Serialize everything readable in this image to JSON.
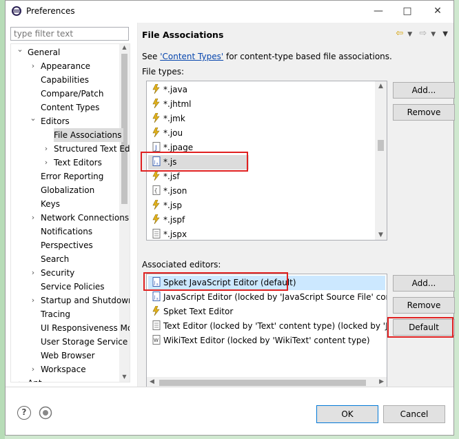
{
  "window": {
    "title": "Preferences",
    "minimize": "—",
    "maximize": "□",
    "close": "✕"
  },
  "filter": {
    "placeholder": "type filter text"
  },
  "tree": {
    "items": [
      {
        "label": "General",
        "level": 0,
        "expander": "open"
      },
      {
        "label": "Appearance",
        "level": 1,
        "expander": "closed"
      },
      {
        "label": "Capabilities",
        "level": 1,
        "expander": "none"
      },
      {
        "label": "Compare/Patch",
        "level": 1,
        "expander": "none"
      },
      {
        "label": "Content Types",
        "level": 1,
        "expander": "none"
      },
      {
        "label": "Editors",
        "level": 1,
        "expander": "open"
      },
      {
        "label": "File Associations",
        "level": 2,
        "expander": "none",
        "selected": true
      },
      {
        "label": "Structured Text Editors",
        "level": 2,
        "expander": "closed"
      },
      {
        "label": "Text Editors",
        "level": 2,
        "expander": "closed"
      },
      {
        "label": "Error Reporting",
        "level": 1,
        "expander": "none"
      },
      {
        "label": "Globalization",
        "level": 1,
        "expander": "none"
      },
      {
        "label": "Keys",
        "level": 1,
        "expander": "none"
      },
      {
        "label": "Network Connections",
        "level": 1,
        "expander": "closed"
      },
      {
        "label": "Notifications",
        "level": 1,
        "expander": "none"
      },
      {
        "label": "Perspectives",
        "level": 1,
        "expander": "none"
      },
      {
        "label": "Search",
        "level": 1,
        "expander": "none"
      },
      {
        "label": "Security",
        "level": 1,
        "expander": "closed"
      },
      {
        "label": "Service Policies",
        "level": 1,
        "expander": "none"
      },
      {
        "label": "Startup and Shutdown",
        "level": 1,
        "expander": "closed"
      },
      {
        "label": "Tracing",
        "level": 1,
        "expander": "none"
      },
      {
        "label": "UI Responsiveness Monitoring",
        "level": 1,
        "expander": "none"
      },
      {
        "label": "User Storage Service",
        "level": 1,
        "expander": "none"
      },
      {
        "label": "Web Browser",
        "level": 1,
        "expander": "none"
      },
      {
        "label": "Workspace",
        "level": 1,
        "expander": "closed"
      },
      {
        "label": "Ant",
        "level": 0,
        "expander": "closed"
      }
    ]
  },
  "page": {
    "title": "File Associations",
    "see_prefix": "See ",
    "see_link": "'Content Types'",
    "see_suffix": " for content-type based file associations.",
    "file_types_label": "File types:",
    "associated_label": "Associated editors:"
  },
  "file_types": [
    {
      "name": "*.java",
      "icon": "lightning-icon"
    },
    {
      "name": "*.jhtml",
      "icon": "lightning-icon"
    },
    {
      "name": "*.jmk",
      "icon": "lightning-icon"
    },
    {
      "name": "*.jou",
      "icon": "lightning-icon"
    },
    {
      "name": "*.jpage",
      "icon": "j-file-icon"
    },
    {
      "name": "*.js",
      "icon": "js-file-icon",
      "selected": true
    },
    {
      "name": "*.jsf",
      "icon": "lightning-icon"
    },
    {
      "name": "*.json",
      "icon": "json-file-icon"
    },
    {
      "name": "*.jsp",
      "icon": "lightning-icon"
    },
    {
      "name": "*.jspf",
      "icon": "lightning-icon"
    },
    {
      "name": "*.jspx",
      "icon": "text-file-icon"
    }
  ],
  "editors": [
    {
      "name": "Spket JavaScript Editor (default)",
      "icon": "js-file-icon",
      "selected": true
    },
    {
      "name": "JavaScript Editor (locked by 'JavaScript Source File' content type)",
      "icon": "js-file-icon"
    },
    {
      "name": "Spket Text Editor",
      "icon": "lightning-icon"
    },
    {
      "name": "Text Editor (locked by 'Text' content type) (locked by 'Java",
      "icon": "text-file-icon"
    },
    {
      "name": "WikiText Editor (locked by 'WikiText' content type)",
      "icon": "wiki-icon"
    }
  ],
  "buttons": {
    "add_types": "Add...",
    "remove_types": "Remove",
    "add_editors": "Add...",
    "remove_editors": "Remove",
    "default": "Default",
    "ok": "OK",
    "cancel": "Cancel"
  },
  "footer": {
    "help_icon": "?"
  },
  "colors": {
    "highlight": "#e02020",
    "selection": "#cce8ff",
    "link": "#0645ad"
  }
}
